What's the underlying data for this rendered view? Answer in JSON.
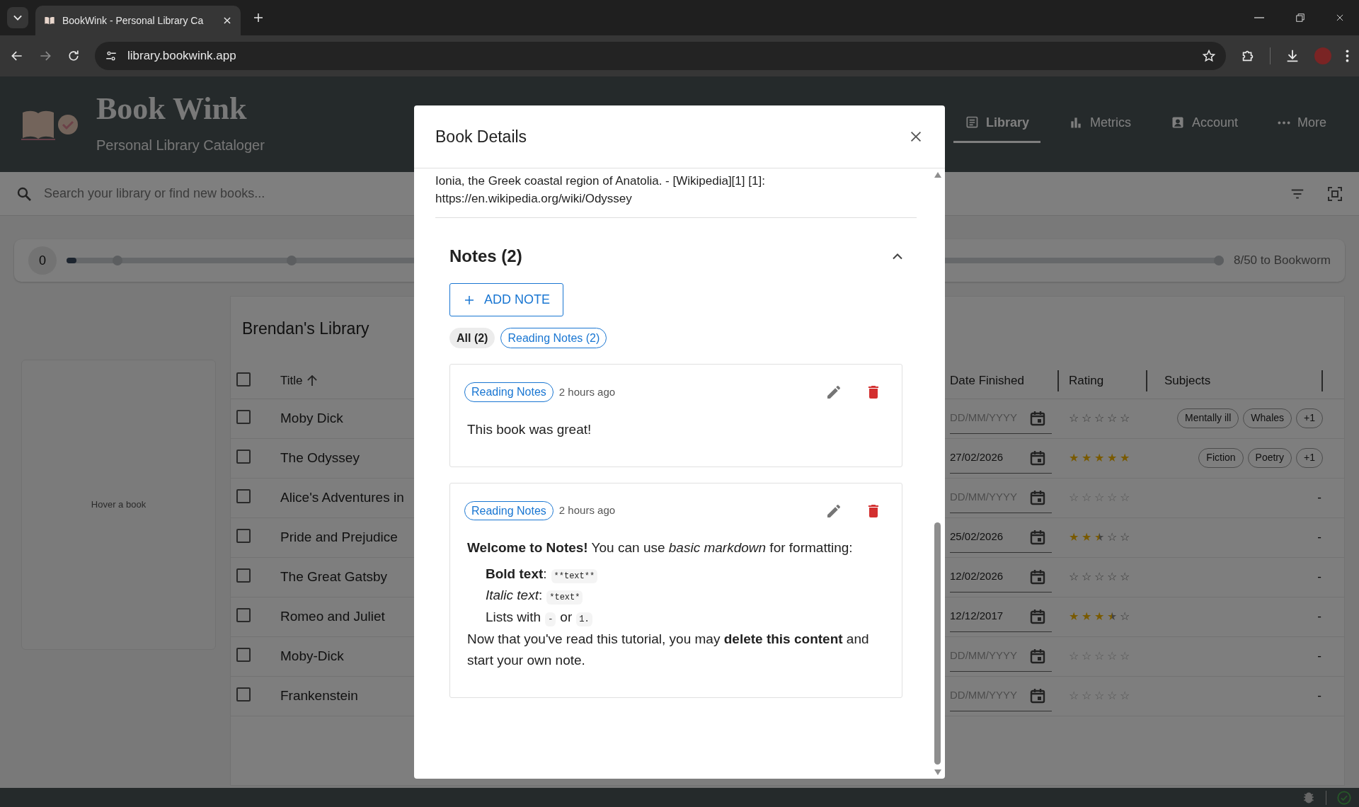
{
  "browser": {
    "tab_title": "BookWink - Personal Library Ca",
    "url": "library.bookwink.app"
  },
  "app": {
    "title": "Book Wink",
    "subtitle": "Personal Library Cataloger"
  },
  "nav": [
    {
      "label": "Library",
      "kind": "library",
      "selected": true
    },
    {
      "label": "Metrics",
      "kind": "metrics",
      "selected": false
    },
    {
      "label": "Account",
      "kind": "account",
      "selected": false
    },
    {
      "label": "More",
      "kind": "more",
      "selected": false
    }
  ],
  "search": {
    "placeholder": "Search your library or find new books..."
  },
  "progress": {
    "count": "0",
    "level": 0,
    "goal": "8/50 to Bookworm"
  },
  "preview": {
    "hint": "Hover a book"
  },
  "library": {
    "title": "Brendan's Library",
    "select_all": {
      "checked": false
    },
    "columns": [
      {
        "label": "Title",
        "sorted": true
      },
      {
        "label": "Date Finished"
      },
      {
        "label": "Rating"
      },
      {
        "label": "Subjects"
      }
    ],
    "rows": [
      {
        "checked": false,
        "title": "Moby Dick",
        "date_placeholder": "DD/MM/YYYY",
        "stars": 0,
        "disabled": false,
        "subjects": [
          "Mentally ill",
          "Whales",
          "+1"
        ]
      },
      {
        "checked": false,
        "title": "The Odyssey",
        "date": "27/02/2026",
        "stars": 5,
        "disabled": false,
        "subjects": [
          "Fiction",
          "Poetry",
          "+1"
        ]
      },
      {
        "checked": false,
        "title": "Alice's Adventures in",
        "date_placeholder": "DD/MM/YYYY",
        "stars": 0,
        "disabled": true,
        "no_subjects": "-"
      },
      {
        "checked": false,
        "title": "Pride and Prejudice",
        "date": "25/02/2026",
        "stars": 2.5,
        "disabled": false,
        "no_subjects": "-"
      },
      {
        "checked": false,
        "title": "The Great Gatsby",
        "date": "12/02/2026",
        "stars": 0,
        "disabled": false,
        "no_subjects": "-"
      },
      {
        "checked": false,
        "title": "Romeo and Juliet",
        "date": "12/12/2017",
        "stars": 3.5,
        "disabled": false,
        "no_subjects": "-"
      },
      {
        "checked": false,
        "title": "Moby-Dick",
        "date_placeholder": "DD/MM/YYYY",
        "stars": 0,
        "disabled": true,
        "no_subjects": "-"
      },
      {
        "checked": false,
        "title": "Frankenstein",
        "date_placeholder": "DD/MM/YYYY",
        "stars": 0,
        "disabled": true,
        "no_subjects": "-"
      }
    ]
  },
  "modal": {
    "title": "Book Details",
    "description": "Ionia, the Greek coastal region of Anatolia. - [Wikipedia][1] [1]: https://en.wikipedia.org/wiki/Odyssey",
    "notes_title": "Notes (2)",
    "expanded": true,
    "add_label": "ADD NOTE",
    "filters": [
      {
        "label": "All (2)",
        "selected": true
      },
      {
        "label": "Reading Notes (2)",
        "selected": false
      }
    ],
    "notes": [
      {
        "tag": "Reading Notes",
        "time": "2 hours ago",
        "blocks": [
          {
            "kind": "paragraph",
            "text": "This book was great!"
          }
        ]
      },
      {
        "tag": "Reading Notes",
        "time": "2 hours ago",
        "blocks": [
          {
            "kind": "paragraph",
            "text": "**Welcome to Notes!** You can use *basic markdown* for formatting:"
          },
          {
            "kind": "list",
            "items": [
              [
                {
                  "kind": "text",
                  "text": "**Bold text**:"
                },
                {
                  "kind": "code",
                  "text": "**text**"
                }
              ],
              [
                {
                  "kind": "text",
                  "text": "*Italic text*:"
                },
                {
                  "kind": "code",
                  "text": "*text*"
                }
              ],
              [
                {
                  "kind": "text",
                  "text": "Lists with"
                },
                {
                  "kind": "code",
                  "text": "-"
                },
                {
                  "kind": "text",
                  "text": "or"
                },
                {
                  "kind": "code",
                  "text": "1."
                }
              ]
            ]
          },
          {
            "kind": "paragraph",
            "text": "Now that you've read this tutorial, you may **delete this content** and start your own note."
          }
        ]
      }
    ]
  }
}
